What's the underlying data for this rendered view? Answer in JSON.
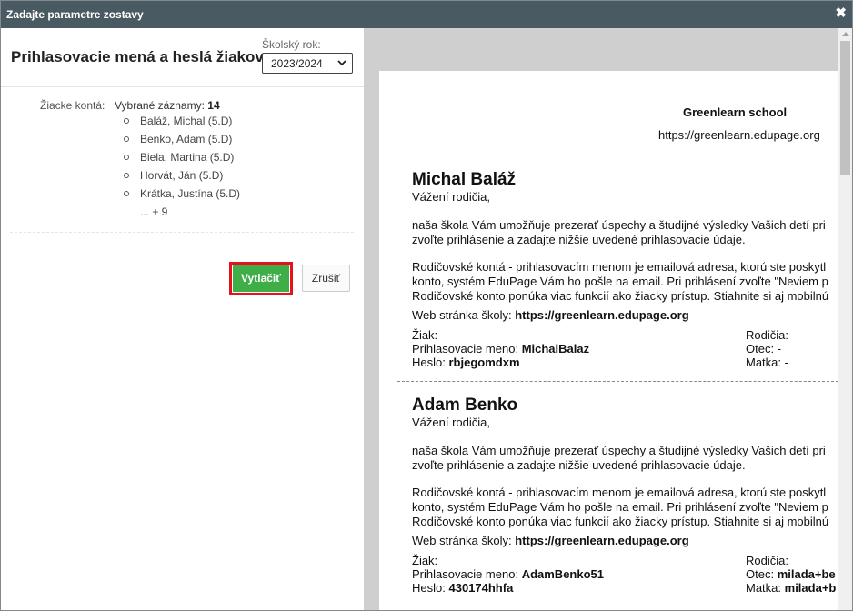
{
  "dialog": {
    "title": "Zadajte parametre zostavy",
    "close_icon": "close-icon"
  },
  "form": {
    "heading": "Prihlasovacie mená a heslá žiakov",
    "school_year_label": "Školský rok:",
    "school_year_value": "2023/2024",
    "accounts_label": "Žiacke kontá:",
    "selected_records_label": "Vybrané záznamy:",
    "selected_records_count": "14",
    "students": [
      "Baláž, Michal (5.D)",
      "Benko, Adam (5.D)",
      "Biela, Martina (5.D)",
      "Horvát, Ján (5.D)",
      "Krátka, Justína (5.D)"
    ],
    "more": "... + 9",
    "print_label": "Vytlačiť",
    "cancel_label": "Zrušiť"
  },
  "preview": {
    "school_name": "Greenlearn school",
    "school_url": "https://greenlearn.edupage.org",
    "salutation": "Vážení  rodičia,",
    "intro_line1": "naša škola Vám umožňuje prezerať úspechy a študijné výsledky Vašich detí pri",
    "intro_line2": "zvoľte prihlásenie a zadajte nižšie uvedené prihlasovacie údaje.",
    "parent_line1": "Rodičovské kontá - prihlasovacím menom je emailová adresa, ktorú ste poskytl",
    "parent_line2": "konto, systém EduPage Vám ho pošle na email. Pri prihlásení zvoľte \"Neviem p",
    "parent_line3": "Rodičovské konto ponúka viac funkcií ako žiacky prístup. Stiahnite si aj mobilnú",
    "web_label": "Web stránka školy:",
    "web_value": "https://greenlearn.edupage.org",
    "student_label": "Žiak:",
    "login_label": "Prihlasovacie meno:",
    "password_label": "Heslo:",
    "parents_label": "Rodičia:",
    "father_label": "Otec:",
    "mother_label": "Matka:",
    "entries": [
      {
        "name": "Michal Baláž",
        "login": "MichalBalaz",
        "password": "rbjegomdxm",
        "father": "-",
        "mother": "-"
      },
      {
        "name": "Adam Benko",
        "login": "AdamBenko51",
        "password": "430174hhfa",
        "father": "milada+be",
        "mother": "milada+b"
      }
    ]
  }
}
